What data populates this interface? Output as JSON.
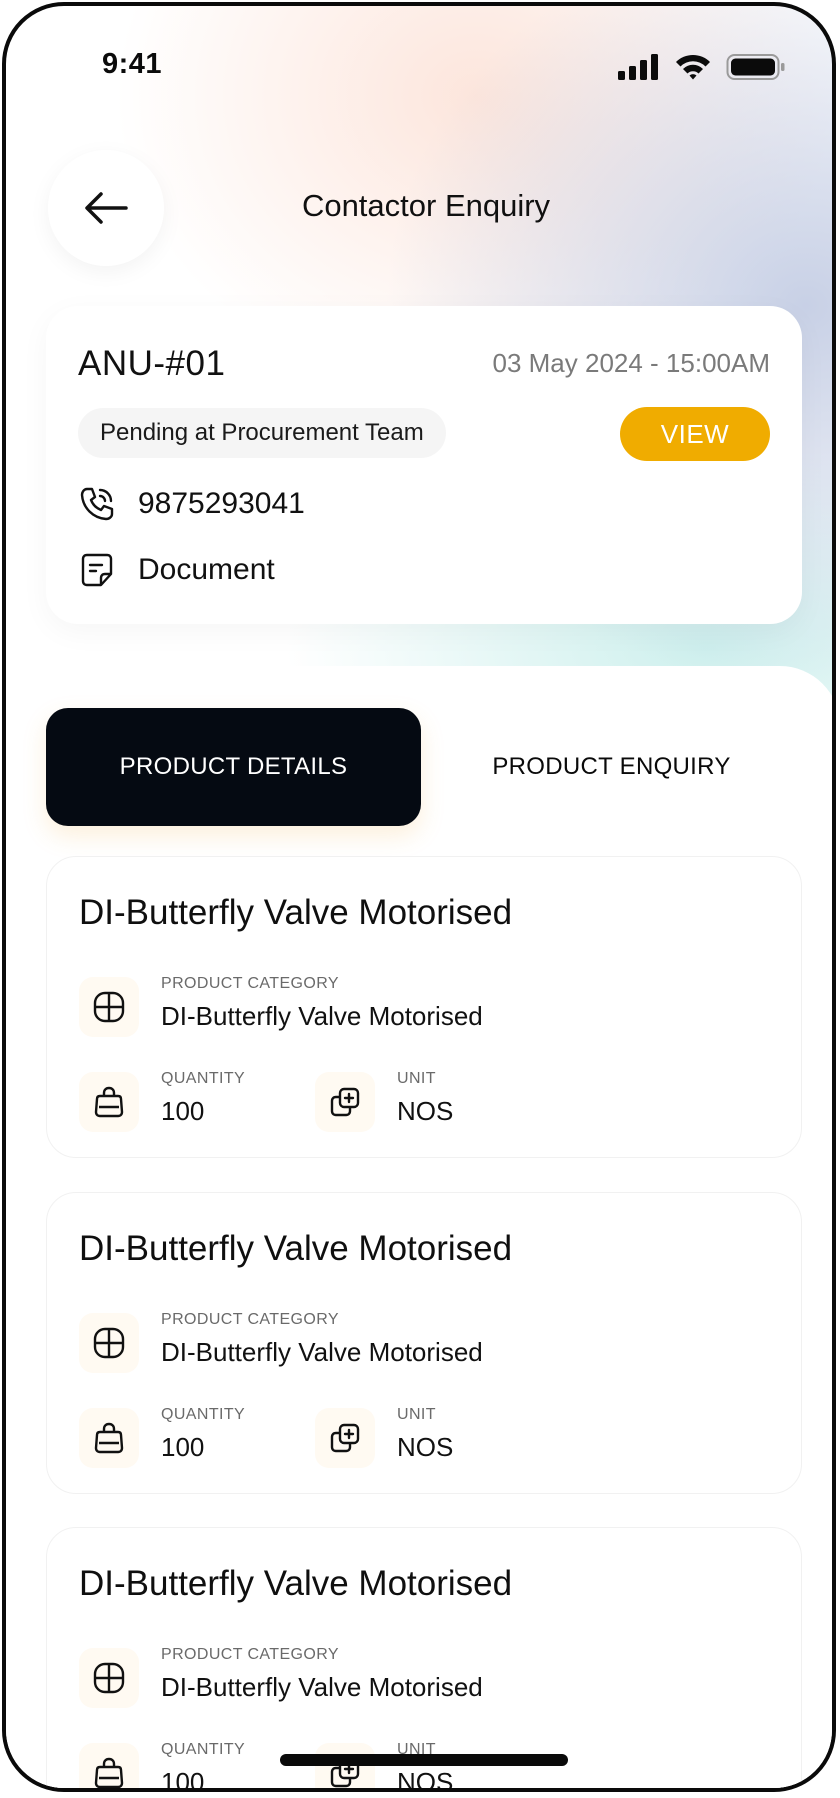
{
  "status_bar": {
    "time": "9:41"
  },
  "header": {
    "title": "Contactor Enquiry"
  },
  "enquiry": {
    "id": "ANU-#01",
    "datetime": "03 May 2024 - 15:00AM",
    "status": "Pending at Procurement Team",
    "view_label": "VIEW",
    "phone": "9875293041",
    "document_label": "Document"
  },
  "tabs": [
    {
      "label": "PRODUCT DETAILS",
      "active": true
    },
    {
      "label": "PRODUCT ENQUIRY",
      "active": false
    }
  ],
  "products": [
    {
      "title": "DI-Butterfly Valve Motorised",
      "category_label": "PRODUCT CATEGORY",
      "category": "DI-Butterfly Valve Motorised",
      "quantity_label": "QUANTITY",
      "quantity": "100",
      "unit_label": "UNIT",
      "unit": "NOS"
    },
    {
      "title": "DI-Butterfly Valve Motorised",
      "category_label": "PRODUCT CATEGORY",
      "category": "DI-Butterfly Valve Motorised",
      "quantity_label": "QUANTITY",
      "quantity": "100",
      "unit_label": "UNIT",
      "unit": "NOS"
    },
    {
      "title": "DI-Butterfly Valve Motorised",
      "category_label": "PRODUCT CATEGORY",
      "category": "DI-Butterfly Valve Motorised",
      "quantity_label": "QUANTITY",
      "quantity": "100",
      "unit_label": "UNIT",
      "unit": "NOS"
    }
  ],
  "colors": {
    "accent": "#f0ac00",
    "tab_active_bg": "#050a12",
    "text": "#111111"
  },
  "icons": {
    "back": "arrow-left-icon",
    "phone": "phone-icon",
    "document": "document-icon",
    "category": "grid-icon",
    "quantity": "bag-icon",
    "unit": "copy-plus-icon"
  }
}
